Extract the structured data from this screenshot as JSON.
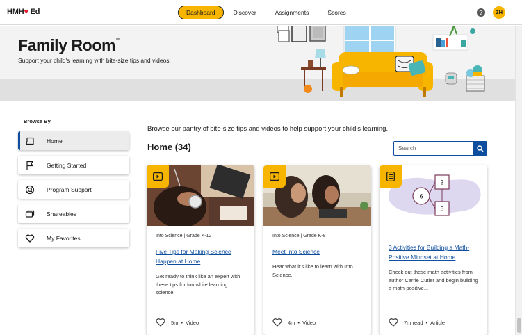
{
  "header": {
    "logo_text": "HMH",
    "logo_mark": "Ed",
    "nav": [
      {
        "label": "Dashboard",
        "active": true
      },
      {
        "label": "Discover",
        "active": false
      },
      {
        "label": "Assignments",
        "active": false
      },
      {
        "label": "Scores",
        "active": false
      }
    ],
    "help_icon": "question-circle-icon",
    "help_glyph": "?",
    "avatar_initials": "ZH"
  },
  "hero": {
    "title": "Family Room",
    "trademark": "™",
    "subtitle": "Support your child's learning with bite-size tips and videos."
  },
  "sidebar": {
    "heading": "Browse By",
    "items": [
      {
        "label": "Home",
        "icon": "home-icon",
        "active": true
      },
      {
        "label": "Getting Started",
        "icon": "flag-icon",
        "active": false
      },
      {
        "label": "Program Support",
        "icon": "lifebuoy-icon",
        "active": false
      },
      {
        "label": "Shareables",
        "icon": "share-screen-icon",
        "active": false
      },
      {
        "label": "My Favorites",
        "icon": "heart-icon",
        "active": false
      }
    ]
  },
  "main": {
    "intro": "Browse our pantry of bite-size tips and videos to help support your child's learning.",
    "heading": "Home (34)",
    "search_placeholder": "Search",
    "cards": [
      {
        "badge": "play-icon",
        "meta": "Into Science  |  Grade K-12",
        "title": "Five Tips for Making Science Happen at Home",
        "description": "Get ready to think like an expert with these tips for fun while learning science.",
        "duration": "5m",
        "type": "Video"
      },
      {
        "badge": "play-icon",
        "meta": "Into Science  |  Grade K-8",
        "title": "Meet Into Science",
        "description": "Hear what it's like to learn with Into Science.",
        "duration": "4m",
        "type": "Video"
      },
      {
        "badge": "article-icon",
        "meta": "",
        "title": "3 Activities for Building a Math-Positive Mindset at Home",
        "description": "Check out these math activities from author Carrie Cutler and begin building a math-positive...",
        "duration": "7m read",
        "type": "Article",
        "diagram_values": [
          "3",
          "6",
          "3"
        ]
      }
    ]
  },
  "colors": {
    "accent_yellow": "#f7b500",
    "link_blue": "#0d4f9e",
    "hero_bg": "#f3f3f3"
  }
}
